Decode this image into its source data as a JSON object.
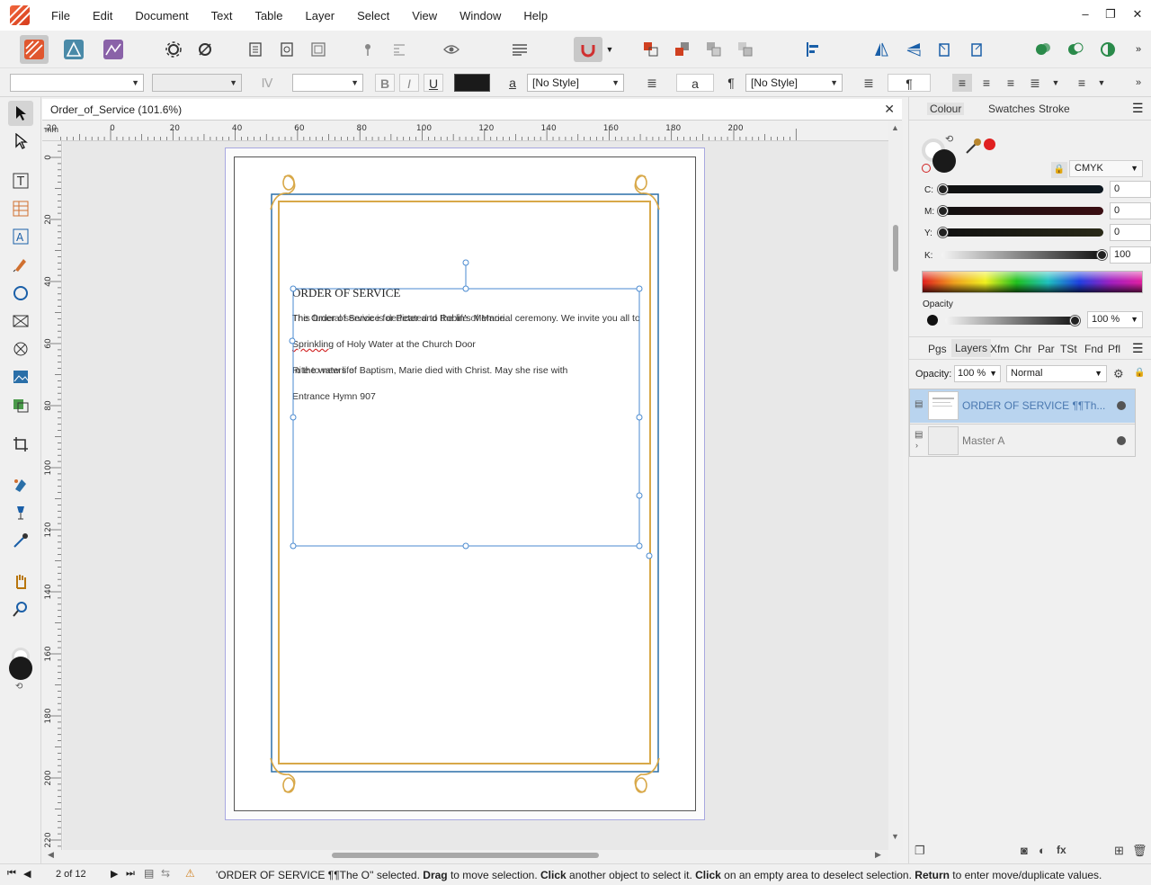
{
  "menu": [
    "File",
    "Edit",
    "Document",
    "Text",
    "Table",
    "Layer",
    "Select",
    "View",
    "Window",
    "Help"
  ],
  "window_controls": {
    "minimize": "–",
    "restore": "❐",
    "close": "✕"
  },
  "context_toolbar": {
    "underline_label": "U",
    "bold_label": "B",
    "italic_label": "I",
    "char_style": "[No Style]",
    "para_style": "[No Style]",
    "char_glyph": "a",
    "case_glyph": "a",
    "pilcrow": "¶"
  },
  "document": {
    "tab_title": "Order_of_Service (101.6%)",
    "close_glyph": "✕"
  },
  "rulers": {
    "unit": "mm",
    "horizontal_ticks": [
      "-40",
      "-20",
      "0",
      "20",
      "40",
      "60",
      "80",
      "100",
      "120",
      "140",
      "160",
      "180",
      "200"
    ],
    "vertical_ticks": [
      "0",
      "20",
      "40",
      "60",
      "80",
      "100",
      "120",
      "140",
      "160",
      "180",
      "200",
      "220"
    ]
  },
  "page": {
    "heading": "ORDER OF SERVICE",
    "line1a": "The Order of Service for Peter and Robin's Memorial ceremony. We invite you all to",
    "line1b": "This funeral service is dedicated to the life of Marie.",
    "line2_underlined": "Sprinkling",
    "line2_rest": " of Holy Water at the Church Door",
    "line3a": "In the waters of Baptism, Marie died with Christ. May she rise with",
    "line3b": "Rite to new life",
    "line4": "Entrance Hymn 907"
  },
  "colour_panel": {
    "tabs": [
      "Colour",
      "Swatches",
      "Stroke"
    ],
    "active_tab": "Colour",
    "model": "CMYK",
    "channels": [
      {
        "label": "C:",
        "value": "0"
      },
      {
        "label": "M:",
        "value": "0"
      },
      {
        "label": "Y:",
        "value": "0"
      },
      {
        "label": "K:",
        "value": "100"
      }
    ],
    "opacity_label": "Opacity",
    "opacity_value": "100 %",
    "fill_color": "#1a1a1a",
    "accent_color": "#e02020"
  },
  "layers_panel": {
    "tabs": [
      "Pgs",
      "Layers",
      "Xfm",
      "Chr",
      "Par",
      "TSt",
      "Fnd",
      "Pfl"
    ],
    "active_tab": "Layers",
    "opacity_label": "Opacity:",
    "opacity_value": "100 %",
    "blend_mode": "Normal",
    "items": [
      {
        "name": "ORDER OF SERVICE ¶¶Th...",
        "selected": true
      },
      {
        "name": "Master A",
        "selected": false
      }
    ]
  },
  "status": {
    "page_indicator": "2 of 12",
    "message_prefix": "'ORDER OF SERVICE ¶¶The O'' selected. ",
    "drag_bold": "Drag",
    "drag_rest": " to move selection. ",
    "click_bold": "Click",
    "click_rest": " another object to select it. ",
    "click2_bold": "Click",
    "click2_rest": " on an empty area to deselect selection. ",
    "return_bold": "Return",
    "return_rest": " to enter move/duplicate values."
  }
}
